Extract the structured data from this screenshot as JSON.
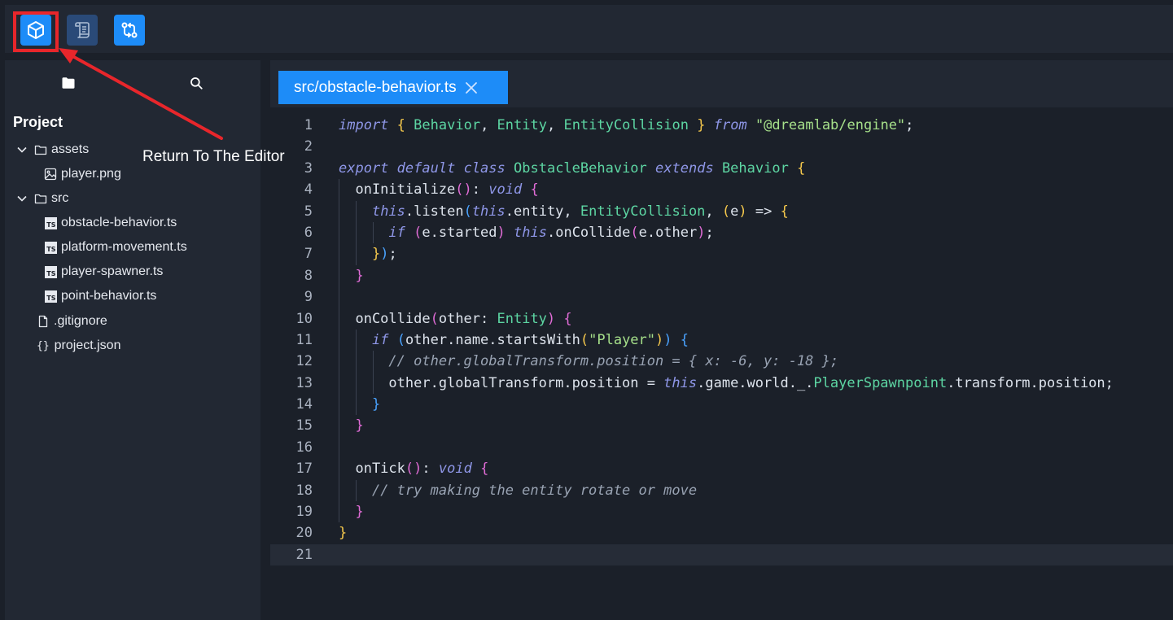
{
  "toolbar": {
    "buttons": [
      {
        "name": "editor",
        "icon": "cube-icon",
        "state": "active"
      },
      {
        "name": "scripts",
        "icon": "scroll-icon",
        "state": "inactive"
      },
      {
        "name": "source-control",
        "icon": "git-compare-icon",
        "state": "inactive"
      }
    ]
  },
  "annotation": {
    "text": "Return To The Editor",
    "color": "#e8262b"
  },
  "sidebar": {
    "tabs": [
      {
        "icon": "folder-icon"
      },
      {
        "icon": "search-icon"
      }
    ],
    "title": "Project",
    "tree": [
      {
        "label": "assets",
        "type": "folder",
        "expanded": true,
        "depth": 0
      },
      {
        "label": "player.png",
        "type": "image",
        "depth": 1
      },
      {
        "label": "src",
        "type": "folder",
        "expanded": true,
        "depth": 0
      },
      {
        "label": "obstacle-behavior.ts",
        "type": "ts",
        "depth": 1
      },
      {
        "label": "platform-movement.ts",
        "type": "ts",
        "depth": 1
      },
      {
        "label": "player-spawner.ts",
        "type": "ts",
        "depth": 1
      },
      {
        "label": "point-behavior.ts",
        "type": "ts",
        "depth": 1
      },
      {
        "label": ".gitignore",
        "type": "file",
        "depth": 0
      },
      {
        "label": "project.json",
        "type": "json",
        "depth": 0
      }
    ]
  },
  "editor": {
    "tab_label": "src/obstacle-behavior.ts",
    "current_line": 21,
    "lines": [
      "import { Behavior, Entity, EntityCollision } from \"@dreamlab/engine\";",
      "",
      "export default class ObstacleBehavior extends Behavior {",
      "  onInitialize(): void {",
      "    this.listen(this.entity, EntityCollision, (e) => {",
      "      if (e.started) this.onCollide(e.other);",
      "    });",
      "  }",
      "",
      "  onCollide(other: Entity) {",
      "    if (other.name.startsWith(\"Player\")) {",
      "      // other.globalTransform.position = { x: -6, y: -18 };",
      "      other.globalTransform.position = this.game.world._.PlayerSpawnpoint.transform.position;",
      "    }",
      "  }",
      "",
      "  onTick(): void {",
      "    // try making the entity rotate or move",
      "  }",
      "}",
      ""
    ]
  },
  "colors": {
    "accent": "#1d8cf8",
    "background": "#1b2029",
    "panel": "#222833"
  }
}
